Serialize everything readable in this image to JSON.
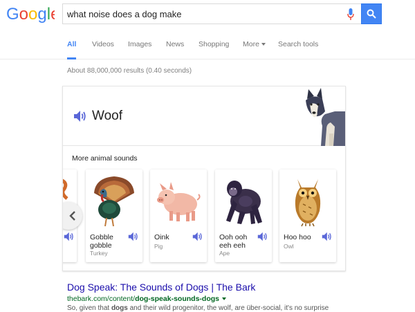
{
  "logo": {
    "text": "Google"
  },
  "search": {
    "query": "what noise does a dog make"
  },
  "tabs": [
    {
      "label": "All",
      "active": true
    },
    {
      "label": "Videos"
    },
    {
      "label": "Images"
    },
    {
      "label": "News"
    },
    {
      "label": "Shopping"
    },
    {
      "label": "More"
    },
    {
      "label": "Search tools"
    }
  ],
  "stats": "About 88,000,000 results (0.40 seconds)",
  "answer": {
    "word": "Woof",
    "icon": "speaker-icon"
  },
  "more_sounds": {
    "title": "More animal sounds",
    "animals": [
      {
        "sound": "Gobble gobble",
        "name": "Turkey"
      },
      {
        "sound": "Oink",
        "name": "Pig"
      },
      {
        "sound": "Ooh ooh eeh eeh",
        "name": "Ape"
      },
      {
        "sound": "Hoo hoo",
        "name": "Owl"
      }
    ]
  },
  "result": {
    "title": "Dog Speak: The Sounds of Dogs | The Bark",
    "url_prefix": "thebark.com/content/",
    "url_bold": "dog-speak-sounds-dogs",
    "snippet_pre": "So, given that ",
    "snippet_bold": "dogs",
    "snippet_post": " and their wild progenitor, the wolf, are über-social, it's no surprise"
  },
  "colors": {
    "accent": "#4285f4",
    "speaker": "#5a67d8",
    "link": "#1a0dab",
    "url": "#006621"
  }
}
